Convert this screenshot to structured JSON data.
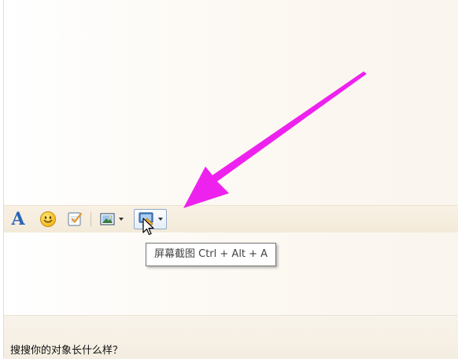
{
  "toolbar": {
    "font_button": {
      "label": "A",
      "icon": "font-icon",
      "color": "#2a64b8"
    },
    "emoji_button": {
      "icon": "smiley-icon"
    },
    "note_button": {
      "icon": "notepad-check-icon"
    },
    "image_button": {
      "icon": "picture-icon"
    },
    "capture_button": {
      "icon": "screen-capture-icon"
    }
  },
  "tooltip": {
    "text": "屏幕截图 Ctrl + Alt + A"
  },
  "bottom": {
    "text": "搜搜你的对象长什么样？"
  },
  "annotation": {
    "arrow_color": "#ee22ee"
  }
}
